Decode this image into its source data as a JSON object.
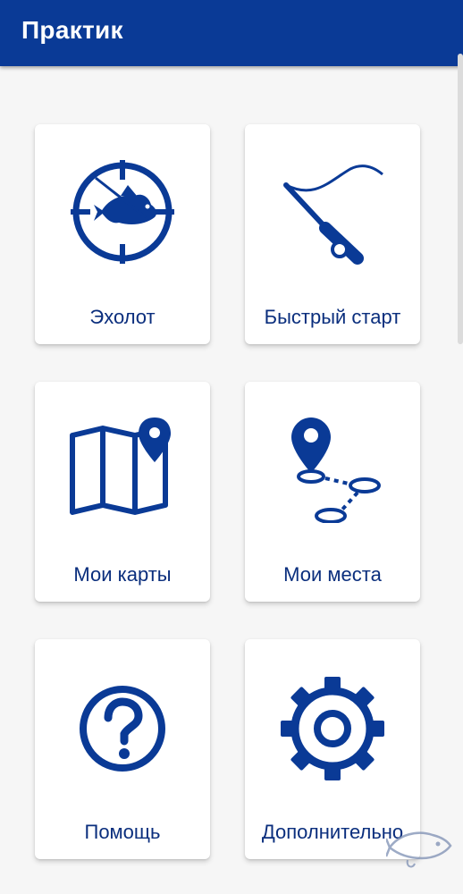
{
  "header": {
    "title": "Практик"
  },
  "tiles": [
    {
      "label": "Эхолот",
      "icon": "fish-sonar-icon"
    },
    {
      "label": "Быстрый старт",
      "icon": "fishing-rod-icon"
    },
    {
      "label": "Мои карты",
      "icon": "map-icon"
    },
    {
      "label": "Мои места",
      "icon": "route-pins-icon"
    },
    {
      "label": "Помощь",
      "icon": "help-icon"
    },
    {
      "label": "Дополнительно",
      "icon": "gear-icon"
    }
  ],
  "colors": {
    "app_bar": "#0a3a96",
    "icon": "#0a3a96",
    "label": "#0a2e7d",
    "background": "#f6f6f6"
  }
}
